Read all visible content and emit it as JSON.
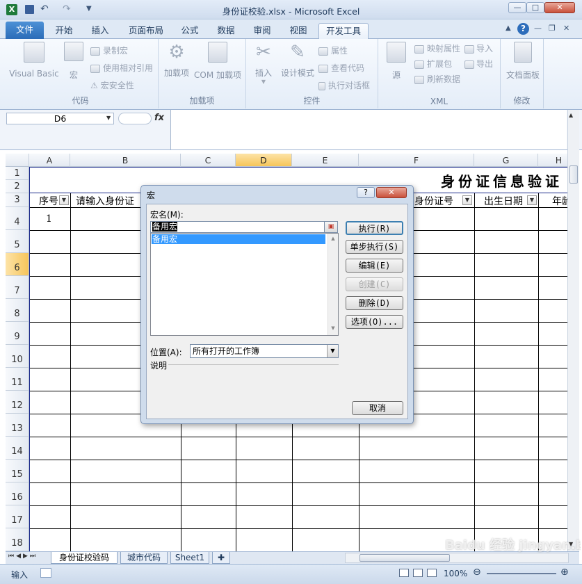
{
  "window": {
    "title": "身份证校验.xlsx - Microsoft Excel",
    "min": "—",
    "max": "□",
    "close": "✕"
  },
  "tabs": [
    "文件",
    "开始",
    "插入",
    "页面布局",
    "公式",
    "数据",
    "审阅",
    "视图",
    "开发工具"
  ],
  "ribbon": {
    "code": {
      "label": "代码",
      "visual_basic": "Visual Basic",
      "macros": "宏",
      "record": "录制宏",
      "relative": "使用相对引用",
      "security": "宏安全性"
    },
    "addins": {
      "label": "加载项",
      "addins": "加载项",
      "com": "COM 加载项"
    },
    "controls": {
      "label": "控件",
      "insert": "插入",
      "design": "设计模式",
      "properties": "属性",
      "view_code": "查看代码",
      "run_dialog": "执行对话框"
    },
    "xml": {
      "label": "XML",
      "source": "源",
      "map": "映射属性",
      "expansion": "扩展包",
      "refresh": "刷新数据",
      "import": "导入",
      "export": "导出"
    },
    "modify": {
      "label": "修改",
      "doc_panel": "文档面板"
    }
  },
  "formula": {
    "name_box": "D6",
    "fx": "fx"
  },
  "columns": [
    "A",
    "B",
    "C",
    "D",
    "E",
    "F",
    "G",
    "H"
  ],
  "rows": [
    "1",
    "2",
    "3",
    "4",
    "5",
    "6",
    "7",
    "8",
    "9",
    "10",
    "11",
    "12",
    "13",
    "14",
    "15",
    "16",
    "17",
    "18"
  ],
  "sheet": {
    "title": "身份证信息验证",
    "header": {
      "seq": "序号",
      "input": "请输入身份证",
      "id": "身份证号",
      "birth": "出生日期",
      "age": "年龄"
    },
    "a4": "1"
  },
  "sheet_tabs": [
    "身份证校验码",
    "城市代码",
    "Sheet1"
  ],
  "status": {
    "mode": "输入",
    "zoom": "100%"
  },
  "dialog": {
    "title": "宏",
    "help": "?",
    "close": "✕",
    "name_label": "宏名(M):",
    "name_value": "备用宏",
    "list": [
      "备用宏"
    ],
    "buttons": {
      "run": "执行(R)",
      "step": "单步执行(S)",
      "edit": "编辑(E)",
      "create": "创建(C)",
      "delete": "删除(D)",
      "options": "选项(O)...",
      "cancel": "取消"
    },
    "location_label": "位置(A):",
    "location_value": "所有打开的工作簿",
    "description_label": "说明"
  },
  "watermark": "Baidu 经验 jingyan.baidu.com"
}
